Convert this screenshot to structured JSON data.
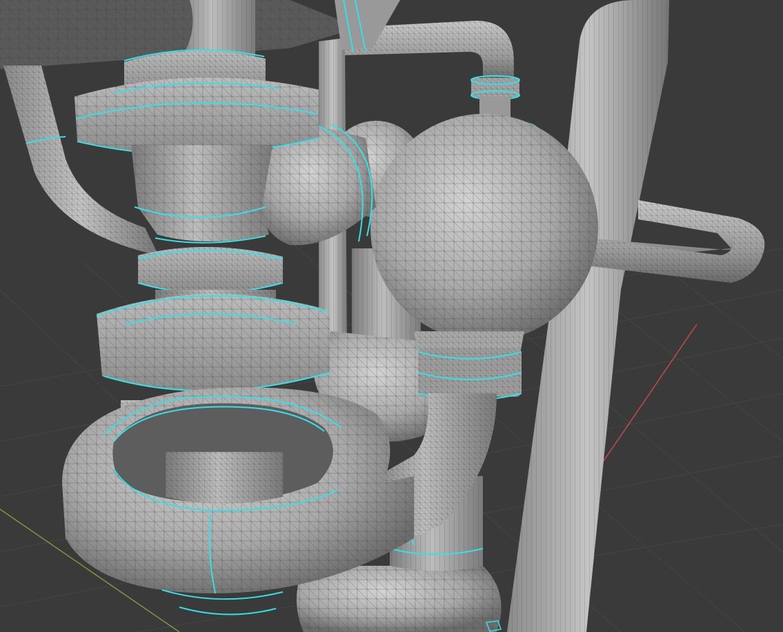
{
  "viewport": {
    "mode": "edit-mode-wireframe-overlay",
    "shading": "solid"
  },
  "colors": {
    "background": "#3a3a3a",
    "grid_line": "#454545",
    "x_axis": "#c24a4a",
    "y_axis": "#7a9a3a",
    "surface_light": "#b9b9b9",
    "surface_mid": "#9a9a9a",
    "surface_dark": "#6f6f6f",
    "wire": "#2a2a2a",
    "selected_edge": "#35e0e6"
  },
  "scene_objects": [
    "central-column",
    "upper-flange",
    "lower-flange",
    "torus-coil",
    "sphere-vessel",
    "small-sphere",
    "bulb-base",
    "vertical-pipe-right",
    "horizontal-pipe-right",
    "pipe-upper-left",
    "pipe-top-bend",
    "pipe-elbow-cylinder"
  ]
}
